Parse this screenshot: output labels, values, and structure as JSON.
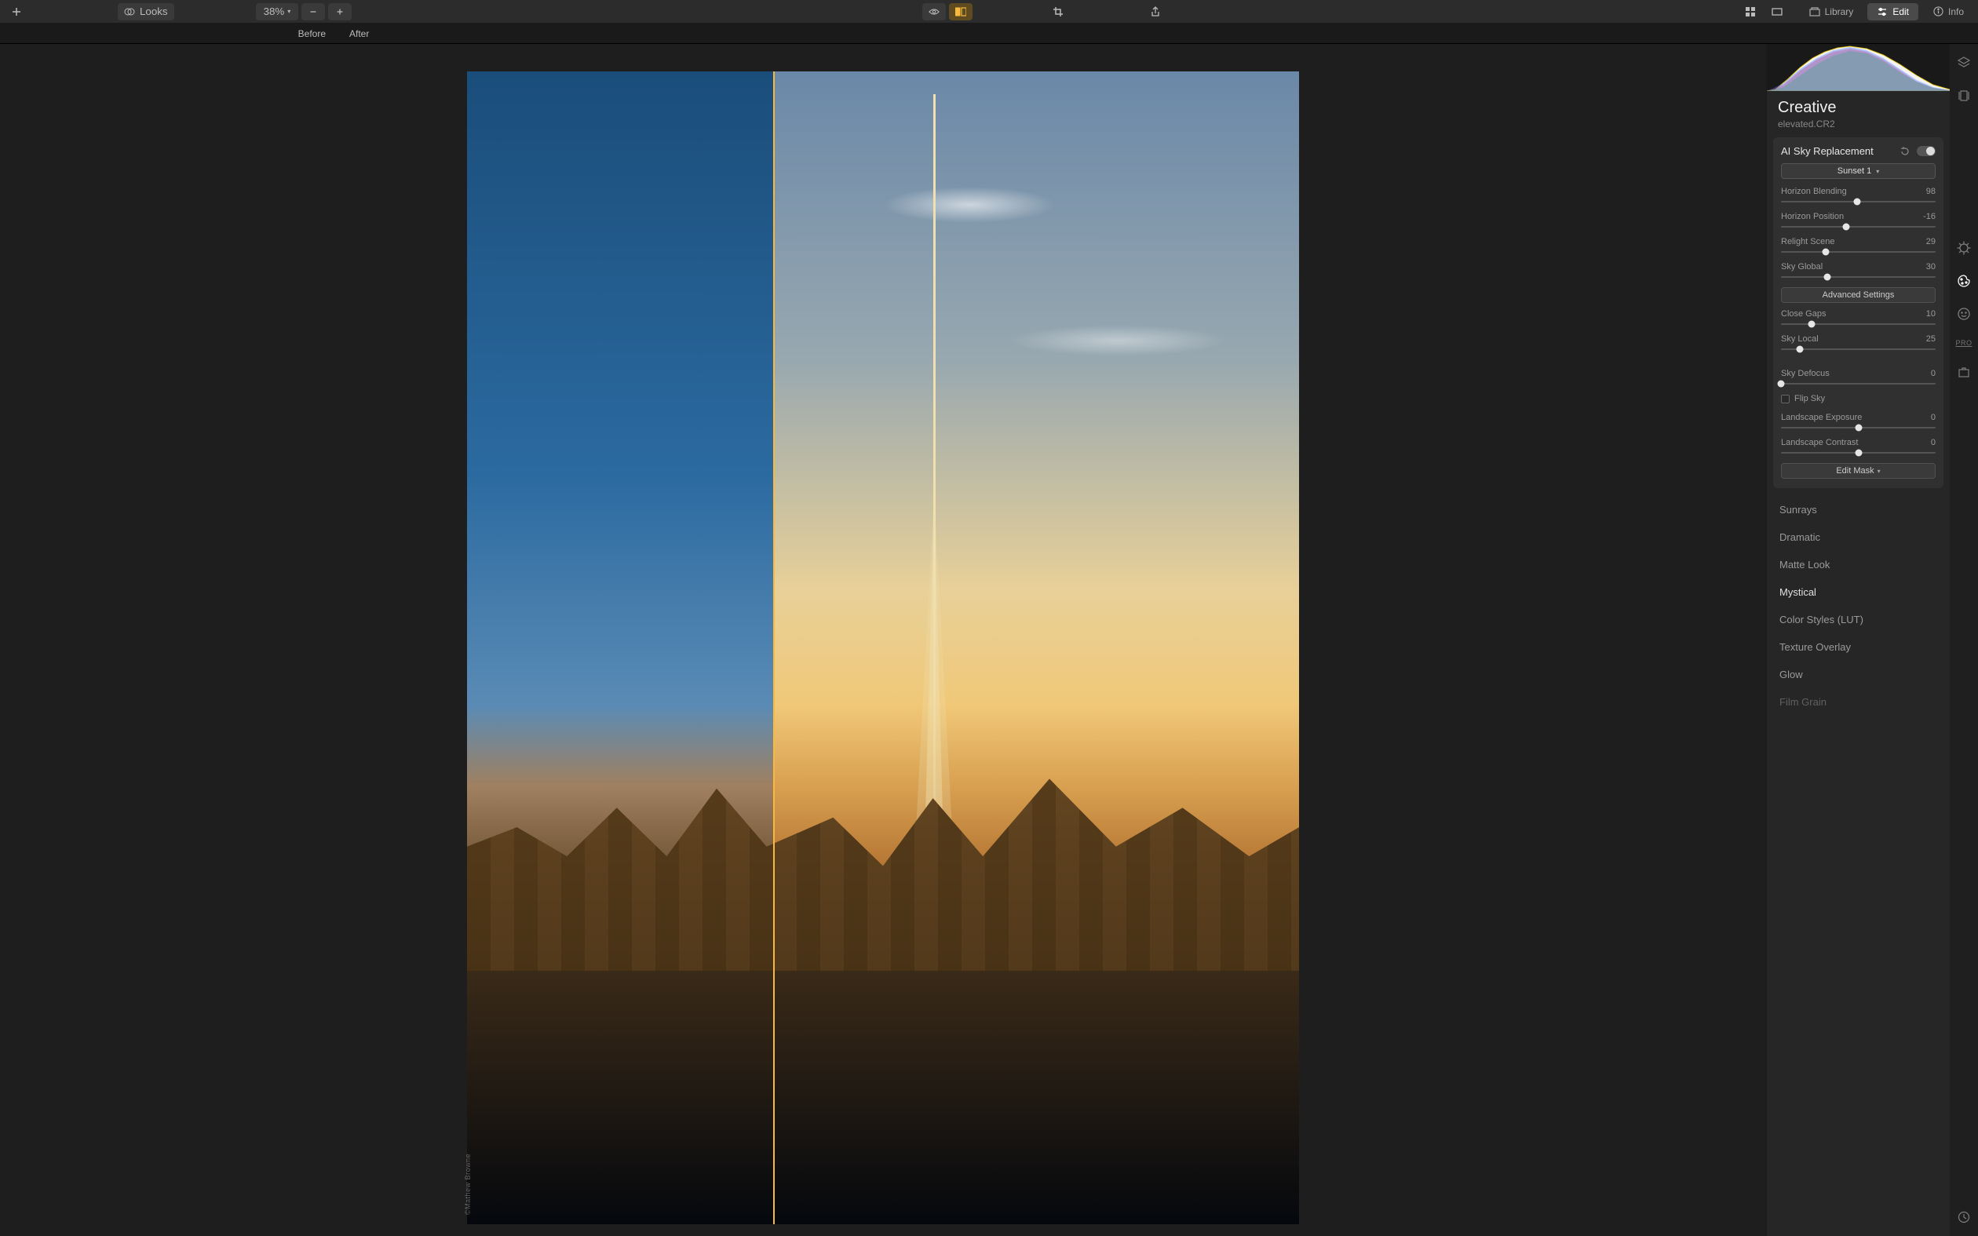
{
  "toolbar": {
    "looks_label": "Looks",
    "zoom_label": "38%",
    "chev": "▾",
    "library_label": "Library",
    "edit_label": "Edit",
    "info_label": "Info"
  },
  "compare": {
    "before_label": "Before",
    "after_label": "After"
  },
  "viewer": {
    "watermark": "©Mathew Browne"
  },
  "panel": {
    "title": "Creative",
    "filename": "elevated.CR2",
    "sky": {
      "title": "AI Sky Replacement",
      "preset": "Sunset 1",
      "chev": "▾",
      "horizon_blending": {
        "label": "Horizon Blending",
        "value": "98",
        "pct": 49
      },
      "horizon_position": {
        "label": "Horizon Position",
        "value": "-16",
        "pct": 42
      },
      "relight_scene": {
        "label": "Relight Scene",
        "value": "29",
        "pct": 29
      },
      "sky_global": {
        "label": "Sky Global",
        "value": "30",
        "pct": 30
      },
      "advanced_label": "Advanced Settings",
      "close_gaps": {
        "label": "Close Gaps",
        "value": "10",
        "pct": 20
      },
      "sky_local": {
        "label": "Sky Local",
        "value": "25",
        "pct": 12
      },
      "sky_defocus": {
        "label": "Sky Defocus",
        "value": "0",
        "pct": 0
      },
      "flip_sky_label": "Flip Sky",
      "landscape_exposure": {
        "label": "Landscape Exposure",
        "value": "0",
        "pct": 50
      },
      "landscape_contrast": {
        "label": "Landscape Contrast",
        "value": "0",
        "pct": 50
      },
      "edit_mask_label": "Edit Mask"
    },
    "tools": {
      "sunrays": "Sunrays",
      "dramatic": "Dramatic",
      "matte_look": "Matte Look",
      "mystical": "Mystical",
      "color_styles": "Color Styles (LUT)",
      "texture_overlay": "Texture Overlay",
      "glow": "Glow",
      "film_grain": "Film Grain"
    }
  },
  "strip": {
    "pro": "PRO"
  }
}
